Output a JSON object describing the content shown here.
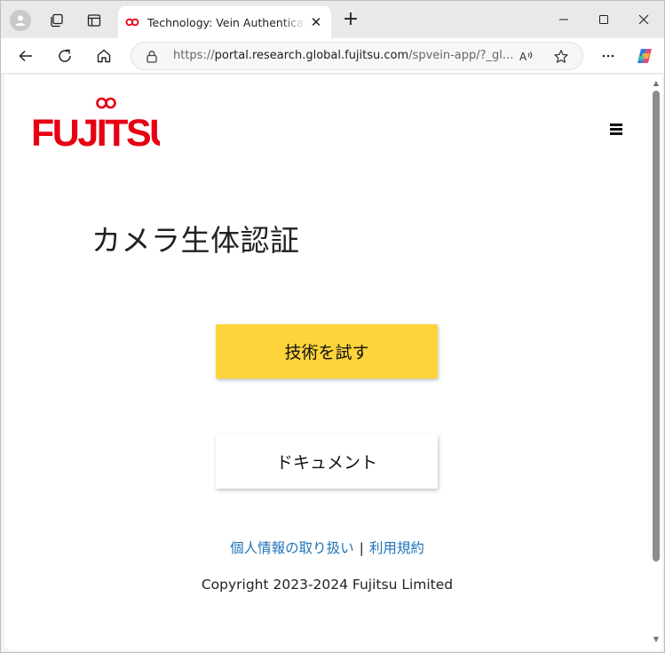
{
  "browser": {
    "tab_title": "Technology: Vein Authentication App",
    "url_scheme": "https://",
    "url_host": "portal.research.global.fujitsu.com",
    "url_path": "/spvein-app/?_gl...",
    "colors": {
      "tab_strip": "#e9e9e9",
      "favicon": "#e60012"
    }
  },
  "page": {
    "logo_text": "FUJITSU",
    "heading": "カメラ生体認証",
    "try_button": "技術を試す",
    "doc_button": "ドキュメント",
    "privacy_link": "個人情報の取り扱い",
    "separator": "|",
    "terms_link": "利用規約",
    "copyright": "Copyright 2023-2024 Fujitsu Limited",
    "colors": {
      "brand_red": "#e60012",
      "primary_button": "#ffd43a",
      "link": "#1f73b7"
    }
  }
}
